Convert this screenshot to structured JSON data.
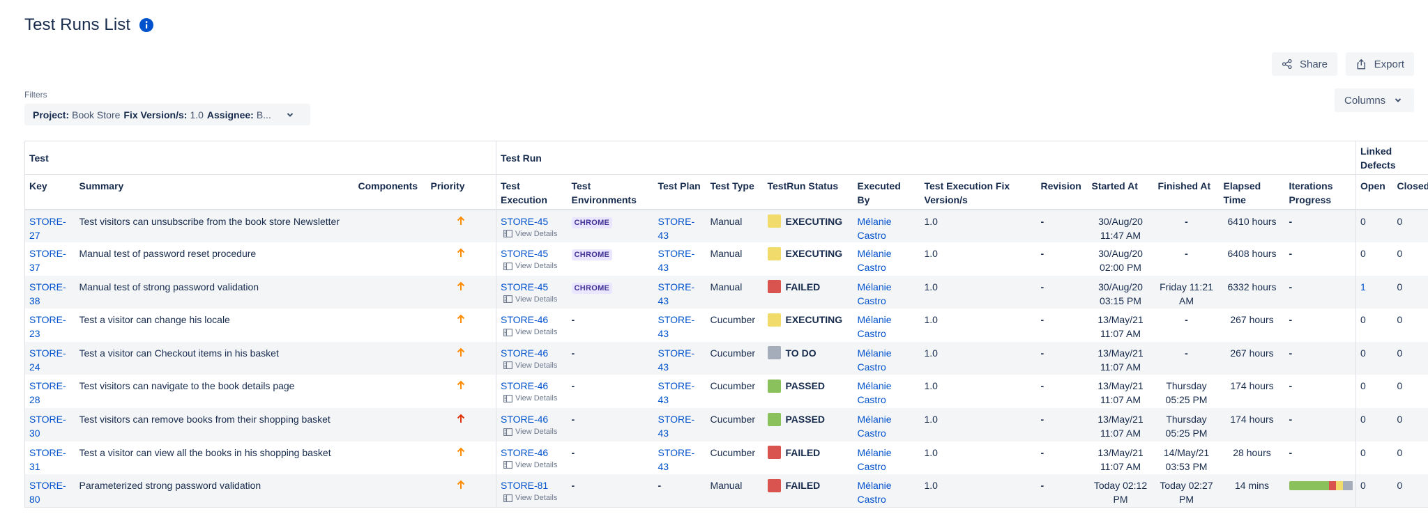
{
  "page": {
    "title": "Test Runs List",
    "info_icon": "info-icon"
  },
  "toolbar": {
    "share_label": "Share",
    "export_label": "Export",
    "columns_label": "Columns"
  },
  "filters": {
    "label": "Filters",
    "project_key": "Project:",
    "project_value": "Book Store",
    "fix_version_key": "Fix Version/s:",
    "fix_version_value": "1.0",
    "assignee_key": "Assignee:",
    "assignee_value": "B..."
  },
  "colors": {
    "link": "#0052cc",
    "executing": "#f1dc6b",
    "failed": "#d9534f",
    "todo": "#a5adba",
    "passed": "#8bc15c",
    "priority_major": "#ff8b00",
    "priority_high": "#de350b",
    "env_badge_bg": "#eae6ff",
    "env_badge_text": "#403294"
  },
  "table": {
    "groups": {
      "test": "Test",
      "test_run": "Test Run",
      "linked_defects": "Linked Defects"
    },
    "columns": {
      "key": "Key",
      "summary": "Summary",
      "components": "Components",
      "priority": "Priority",
      "test_execution": "Test Execution",
      "test_environments": "Test Environments",
      "test_plan": "Test Plan",
      "test_type": "Test Type",
      "testrun_status": "TestRun Status",
      "executed_by": "Executed By",
      "test_execution_fix_version": "Test Execution Fix Version/s",
      "revision": "Revision",
      "started_at": "Started At",
      "finished_at": "Finished At",
      "elapsed_time": "Elapsed Time",
      "iterations_progress": "Iterations Progress",
      "open": "Open",
      "closed": "Closed"
    },
    "view_details_label": "View Details",
    "rows": [
      {
        "key": "STORE-27",
        "summary": "Test visitors can unsubscribe from the book store Newsletter",
        "components": "",
        "priority_icon": "arrow-up-icon",
        "priority_color": "#ff8b00",
        "execution": "STORE-45",
        "environment": "CHROME",
        "plan": "STORE-43",
        "type": "Manual",
        "status": "EXECUTING",
        "status_color": "#f1dc6b",
        "executed_by": "Mélanie Castro",
        "fix_version": "1.0",
        "revision": "-",
        "started_at": "30/Aug/20 11:47 AM",
        "finished_at": "-",
        "elapsed": "6410 hours",
        "iterations": "-",
        "iterations_bar": null,
        "open": "0",
        "open_link": false,
        "closed": "0"
      },
      {
        "key": "STORE-37",
        "summary": "Manual test of password reset procedure",
        "components": "",
        "priority_icon": "arrow-up-icon",
        "priority_color": "#ff8b00",
        "execution": "STORE-45",
        "environment": "CHROME",
        "plan": "STORE-43",
        "type": "Manual",
        "status": "EXECUTING",
        "status_color": "#f1dc6b",
        "executed_by": "Mélanie Castro",
        "fix_version": "1.0",
        "revision": "-",
        "started_at": "30/Aug/20 02:00 PM",
        "finished_at": "-",
        "elapsed": "6408 hours",
        "iterations": "-",
        "iterations_bar": null,
        "open": "0",
        "open_link": false,
        "closed": "0"
      },
      {
        "key": "STORE-38",
        "summary": "Manual test of strong password validation",
        "components": "",
        "priority_icon": "arrow-up-icon",
        "priority_color": "#ff8b00",
        "execution": "STORE-45",
        "environment": "CHROME",
        "plan": "STORE-43",
        "type": "Manual",
        "status": "FAILED",
        "status_color": "#d9534f",
        "executed_by": "Mélanie Castro",
        "fix_version": "1.0",
        "revision": "-",
        "started_at": "30/Aug/20 03:15 PM",
        "finished_at": "Friday 11:21 AM",
        "elapsed": "6332 hours",
        "iterations": "-",
        "iterations_bar": null,
        "open": "1",
        "open_link": true,
        "closed": "0"
      },
      {
        "key": "STORE-23",
        "summary": "Test a visitor can change his locale",
        "components": "",
        "priority_icon": "arrow-up-icon",
        "priority_color": "#ff8b00",
        "execution": "STORE-46",
        "environment": "-",
        "plan": "STORE-43",
        "type": "Cucumber",
        "status": "EXECUTING",
        "status_color": "#f1dc6b",
        "executed_by": "Mélanie Castro",
        "fix_version": "1.0",
        "revision": "-",
        "started_at": "13/May/21 11:07 AM",
        "finished_at": "-",
        "elapsed": "267 hours",
        "iterations": "-",
        "iterations_bar": null,
        "open": "0",
        "open_link": false,
        "closed": "0"
      },
      {
        "key": "STORE-24",
        "summary": "Test a visitor can Checkout items in his basket",
        "components": "",
        "priority_icon": "arrow-up-icon",
        "priority_color": "#ff8b00",
        "execution": "STORE-46",
        "environment": "-",
        "plan": "STORE-43",
        "type": "Cucumber",
        "status": "TO DO",
        "status_color": "#a5adba",
        "executed_by": "Mélanie Castro",
        "fix_version": "1.0",
        "revision": "-",
        "started_at": "13/May/21 11:07 AM",
        "finished_at": "-",
        "elapsed": "267 hours",
        "iterations": "-",
        "iterations_bar": null,
        "open": "0",
        "open_link": false,
        "closed": "0"
      },
      {
        "key": "STORE-28",
        "summary": "Test visitors can navigate to the book details page",
        "components": "",
        "priority_icon": "arrow-up-icon",
        "priority_color": "#ff8b00",
        "execution": "STORE-46",
        "environment": "-",
        "plan": "STORE-43",
        "type": "Cucumber",
        "status": "PASSED",
        "status_color": "#8bc15c",
        "executed_by": "Mélanie Castro",
        "fix_version": "1.0",
        "revision": "-",
        "started_at": "13/May/21 11:07 AM",
        "finished_at": "Thursday 05:25 PM",
        "elapsed": "174 hours",
        "iterations": "-",
        "iterations_bar": null,
        "open": "0",
        "open_link": false,
        "closed": "0"
      },
      {
        "key": "STORE-30",
        "summary": "Test visitors can remove books from their shopping basket",
        "components": "",
        "priority_icon": "arrow-up-icon",
        "priority_color": "#de350b",
        "execution": "STORE-46",
        "environment": "-",
        "plan": "STORE-43",
        "type": "Cucumber",
        "status": "PASSED",
        "status_color": "#8bc15c",
        "executed_by": "Mélanie Castro",
        "fix_version": "1.0",
        "revision": "-",
        "started_at": "13/May/21 11:07 AM",
        "finished_at": "Thursday 05:25 PM",
        "elapsed": "174 hours",
        "iterations": "-",
        "iterations_bar": null,
        "open": "0",
        "open_link": false,
        "closed": "0"
      },
      {
        "key": "STORE-31",
        "summary": "Test a visitor can view all the books in his shopping basket",
        "components": "",
        "priority_icon": "arrow-up-icon",
        "priority_color": "#ff8b00",
        "execution": "STORE-46",
        "environment": "-",
        "plan": "STORE-43",
        "type": "Cucumber",
        "status": "FAILED",
        "status_color": "#d9534f",
        "executed_by": "Mélanie Castro",
        "fix_version": "1.0",
        "revision": "-",
        "started_at": "13/May/21 11:07 AM",
        "finished_at": "14/May/21 03:53 PM",
        "elapsed": "28 hours",
        "iterations": "-",
        "iterations_bar": null,
        "open": "0",
        "open_link": false,
        "closed": "0"
      },
      {
        "key": "STORE-80",
        "summary": "Parameterized strong password validation",
        "components": "",
        "priority_icon": "arrow-up-icon",
        "priority_color": "#ff8b00",
        "execution": "STORE-81",
        "environment": "-",
        "plan": "-",
        "type": "Manual",
        "status": "FAILED",
        "status_color": "#d9534f",
        "executed_by": "Mélanie Castro",
        "fix_version": "1.0",
        "revision": "-",
        "started_at": "Today 02:12 PM",
        "finished_at": "Today 02:27 PM",
        "elapsed": "14 mins",
        "iterations": "",
        "iterations_bar": [
          {
            "status": "passed",
            "fraction": 0.62,
            "color": "#8bc15c"
          },
          {
            "status": "failed",
            "fraction": 0.11,
            "color": "#d9534f"
          },
          {
            "status": "executing",
            "fraction": 0.11,
            "color": "#f1dc6b"
          },
          {
            "status": "todo",
            "fraction": 0.16,
            "color": "#a5adba"
          }
        ],
        "open": "0",
        "open_link": false,
        "closed": "0"
      }
    ]
  }
}
